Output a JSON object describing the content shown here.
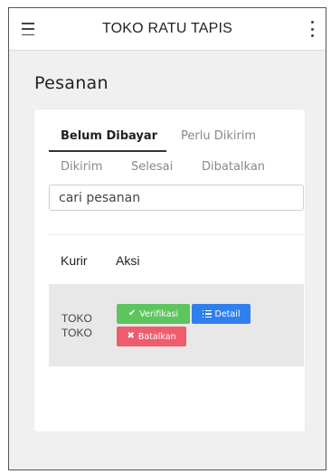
{
  "appbar": {
    "title": "TOKO RATU TAPIS",
    "menu_icon": "hamburger-menu-icon",
    "more_icon": "vertical-ellipsis-icon"
  },
  "page": {
    "title": "Pesanan"
  },
  "tabs": [
    {
      "label": "Belum Dibayar",
      "active": true
    },
    {
      "label": "Perlu Dikirim",
      "active": false
    },
    {
      "label": "Dikirim",
      "active": false
    },
    {
      "label": "Selesai",
      "active": false
    },
    {
      "label": "Dibatalkan",
      "active": false
    }
  ],
  "search": {
    "placeholder": "cari pesanan",
    "value": ""
  },
  "table": {
    "columns": [
      "Kurir",
      "Aksi"
    ],
    "rows": [
      {
        "courier": "TOKO\nTOKO",
        "actions": {
          "verify": {
            "label": "Verifikasi",
            "icon": "check-icon",
            "color": "#5cc55c"
          },
          "detail": {
            "label": "Detail",
            "icon": "list-icon",
            "color": "#2f7fef"
          },
          "cancel": {
            "label": "Batalkan",
            "icon": "x-icon",
            "color": "#ee5d6c"
          }
        }
      }
    ]
  }
}
